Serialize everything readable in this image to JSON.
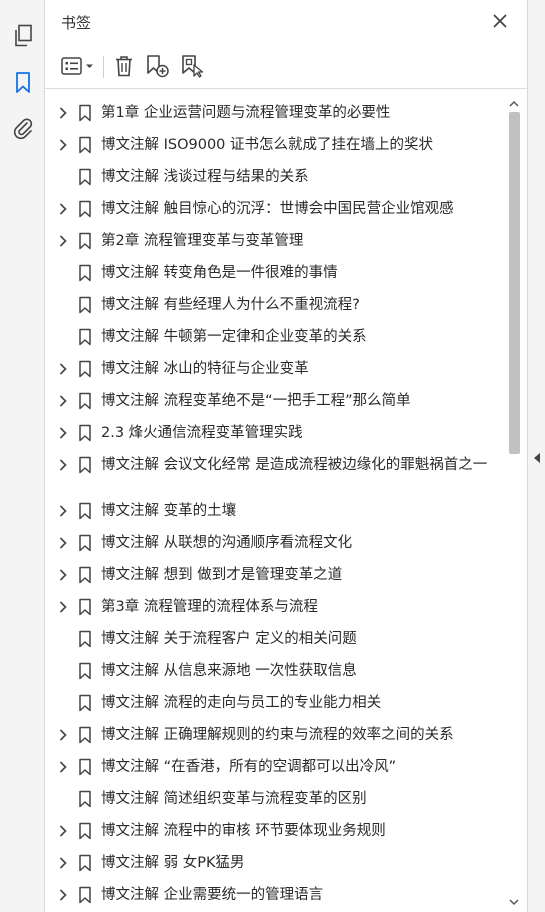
{
  "panel": {
    "title": "书签"
  },
  "rail": {
    "items": [
      {
        "icon": "pages-icon"
      },
      {
        "icon": "bookmark-icon"
      },
      {
        "icon": "attachment-icon"
      }
    ]
  },
  "toolbar": {
    "buttons": [
      "options-menu-icon",
      "delete-icon",
      "new-bookmark-icon",
      "new-bookmark-from-selection-icon"
    ]
  },
  "bookmarks": [
    {
      "label": "第1章 企业运营问题与流程管理变革的必要性",
      "expandable": true
    },
    {
      "label": "博文注解 ISO9000 证书怎么就成了挂在墙上的奖状",
      "expandable": true
    },
    {
      "label": "博文注解 浅谈过程与结果的关系",
      "expandable": false
    },
    {
      "label": "博文注解 触目惊心的沉浮：世博会中国民营企业馆观感",
      "expandable": true
    },
    {
      "label": "第2章 流程管理变革与变革管理",
      "expandable": true
    },
    {
      "label": "博文注解 转变角色是一件很难的事情",
      "expandable": false
    },
    {
      "label": "博文注解 有些经理人为什么不重视流程?",
      "expandable": false
    },
    {
      "label": "博文注解 牛顿第一定律和企业变革的关系",
      "expandable": false
    },
    {
      "label": "博文注解 冰山的特征与企业变革",
      "expandable": true
    },
    {
      "label": "博文注解 流程变革绝不是“一把手工程”那么简单",
      "expandable": true
    },
    {
      "label": "2.3 烽火通信流程变革管理实践",
      "expandable": true
    },
    {
      "label": "博文注解 会议文化经常 是造成流程被边缘化的罪魁祸首之一",
      "expandable": true
    },
    {
      "label": "博文注解 变革的土壤",
      "expandable": true
    },
    {
      "label": "博文注解 从联想的沟通顺序看流程文化",
      "expandable": true
    },
    {
      "label": "博文注解 想到 做到才是管理变革之道",
      "expandable": true
    },
    {
      "label": "第3章 流程管理的流程体系与流程",
      "expandable": true
    },
    {
      "label": "博文注解 关于流程客户 定义的相关问题",
      "expandable": false
    },
    {
      "label": "博文注解 从信息来源地 一次性获取信息",
      "expandable": false
    },
    {
      "label": "博文注解 流程的走向与员工的专业能力相关",
      "expandable": false
    },
    {
      "label": "博文注解 正确理解规则的约束与流程的效率之间的关系",
      "expandable": true
    },
    {
      "label": "博文注解 “在香港，所有的空调都可以出冷风”",
      "expandable": true
    },
    {
      "label": "博文注解 简述组织变革与流程变革的区别",
      "expandable": false
    },
    {
      "label": "博文注解 流程中的审核 环节要体现业务规则",
      "expandable": true
    },
    {
      "label": "博文注解 弱 女PK猛男",
      "expandable": true
    },
    {
      "label": "博文注解 企业需要统一的管理语言",
      "expandable": true
    }
  ]
}
